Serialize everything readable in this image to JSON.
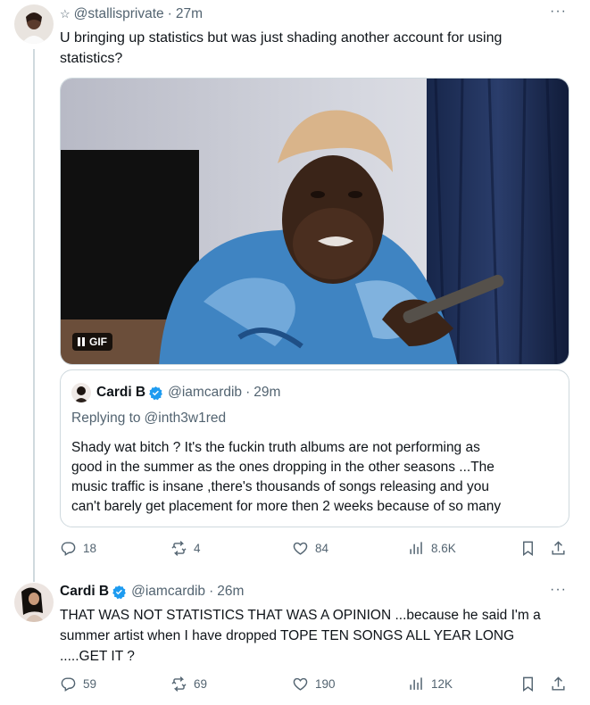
{
  "tweet1": {
    "handle": "@stallisprivate",
    "separator": "·",
    "time": "27m",
    "text_line1": "U bringing up statistics but was just shading another account for using",
    "text_line2": "statistics?",
    "gif_label": "GIF",
    "quote": {
      "name": "Cardi B",
      "handle": "@iamcardib",
      "separator": "·",
      "time": "29m",
      "replying_prefix": "Replying to",
      "replying_to": "@inth3w1red",
      "lines": [
        "Shady wat bitch ? It's the fuckin truth albums are not performing as",
        "good in the summer as the ones  dropping in the other seasons ...The",
        "music traffic is insane ,there's thousands of songs releasing and you",
        "can't barely get placement for more then 2 weeks because of so many"
      ]
    },
    "actions": {
      "replies": "18",
      "retweets": "4",
      "likes": "84",
      "views": "8.6K"
    }
  },
  "tweet2": {
    "name": "Cardi B",
    "handle": "@iamcardib",
    "separator": "·",
    "time": "26m",
    "lines": [
      "THAT WAS NOT STATISTICS THAT WAS A OPINION ...because he said I'm a",
      "summer artist when I have dropped TOPE TEN SONGS ALL YEAR LONG",
      ".....GET IT ?"
    ],
    "actions": {
      "replies": "59",
      "retweets": "69",
      "likes": "190",
      "views": "12K"
    }
  },
  "more_glyph": "···",
  "star_glyph": "☆",
  "colors": {
    "text": "#0f1419",
    "secondary": "#536471",
    "border": "#cfd9de",
    "verified": "#1d9bf0"
  }
}
